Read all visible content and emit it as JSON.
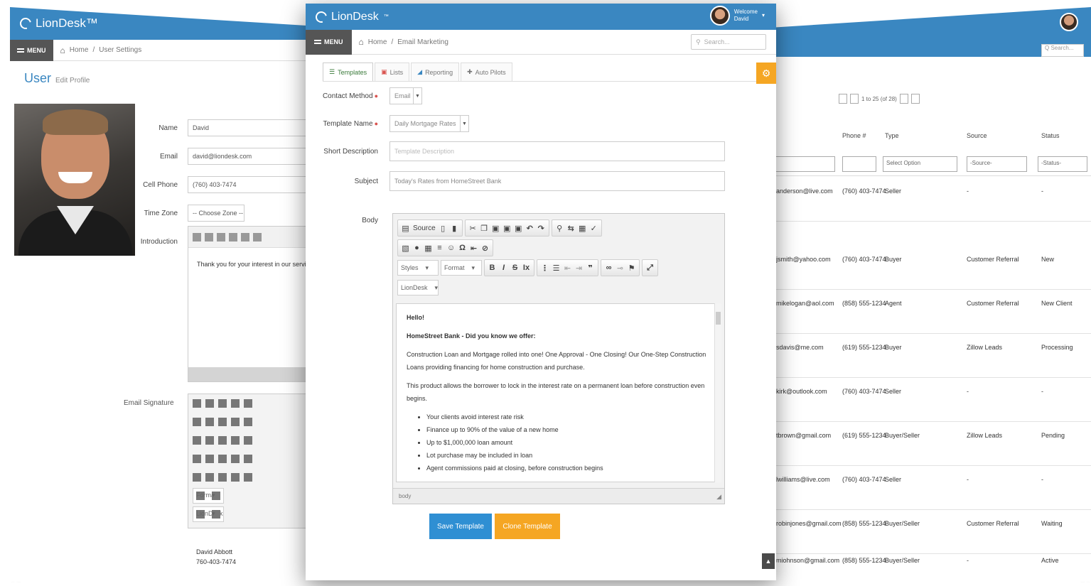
{
  "brand": {
    "name": "LionDesk",
    "mark": "™"
  },
  "colors": {
    "header": "#3a87c1",
    "save": "#2f8fd3",
    "clone": "#f5a623",
    "required": "#d9534f"
  },
  "left": {
    "logo": "LionDesk™",
    "menu": "MENU",
    "breadcrumb": [
      "Home",
      "User Settings"
    ],
    "title": "User",
    "title_small": "Edit Profile",
    "fields": [
      {
        "label": "Name",
        "value": "David"
      },
      {
        "label": "Email",
        "value": "david@liondesk.com"
      },
      {
        "label": "Cell Phone",
        "value": "(760) 403-7474"
      },
      {
        "label": "Time Zone",
        "value": "-- Choose Zone --"
      },
      {
        "label": "Introduction",
        "value": ""
      }
    ],
    "intro_text": "Thank you for your interest in our services",
    "signature_label": "Email Signature",
    "signature_lines": [
      "David Abbott",
      "760-403-7474"
    ],
    "format_combo": "Format",
    "liondesk_combo": "LionDesk"
  },
  "right": {
    "search_placeholder": "Q Search...",
    "pager": "1 to 25 (of 28)",
    "columns": [
      "Phone #",
      "Type",
      "Source",
      "Status"
    ],
    "filters": [
      "Select Option",
      "-Source-",
      "-Status-"
    ],
    "rows": [
      {
        "email": "anderson@live.com",
        "phone": "(760) 403-7474",
        "type": "Seller",
        "source": "-",
        "status": "-"
      },
      {
        "email": "jsmith@yahoo.com",
        "phone": "(760) 403-7474",
        "type": "Buyer",
        "source": "Customer Referral",
        "status": "New"
      },
      {
        "email": "mikelogan@aol.com",
        "phone": "(858) 555-1234",
        "type": "Agent",
        "source": "Customer Referral",
        "status": "New Client"
      },
      {
        "email": "sdavis@me.com",
        "phone": "(619) 555-1234",
        "type": "Buyer",
        "source": "Zillow Leads",
        "status": "Processing"
      },
      {
        "email": "kirk@outlook.com",
        "phone": "(760) 403-7474",
        "type": "Seller",
        "source": "-",
        "status": "-"
      },
      {
        "email": "tbrown@gmail.com",
        "phone": "(619) 555-1234",
        "type": "Buyer/Seller",
        "source": "Zillow Leads",
        "status": "Pending"
      },
      {
        "email": "lwilliams@live.com",
        "phone": "(760) 403-7474",
        "type": "Seller",
        "source": "-",
        "status": "-"
      },
      {
        "email": "robinjones@gmail.com",
        "phone": "(858) 555-1234",
        "type": "Buyer/Seller",
        "source": "Customer Referral",
        "status": "Waiting"
      },
      {
        "email": "mjohnson@gmail.com",
        "phone": "(858) 555-1234",
        "type": "Buyer/Seller",
        "source": "-",
        "status": "Active"
      }
    ]
  },
  "center": {
    "logo": "LionDesk",
    "logo_mark": "™",
    "user": {
      "welcome": "Welcome",
      "name": "David"
    },
    "menu": "MENU",
    "breadcrumb": {
      "home": "Home",
      "sep": "/",
      "current": "Email Marketing"
    },
    "search_placeholder": "Search...",
    "tabs": [
      {
        "label": "Templates",
        "icon": "☰"
      },
      {
        "label": "Lists",
        "icon": "▣"
      },
      {
        "label": "Reporting",
        "icon": "◢"
      },
      {
        "label": "Auto Pilots",
        "icon": "✚"
      }
    ],
    "form": {
      "contact_method": {
        "label": "Contact Method",
        "value": "Email"
      },
      "template_name": {
        "label": "Template Name",
        "value": "Daily Mortgage Rates"
      },
      "short_description": {
        "label": "Short Description",
        "placeholder": "Template Description"
      },
      "subject": {
        "label": "Subject",
        "value": "Today's Rates from HomeStreet Bank"
      },
      "body_label": "Body"
    },
    "editor": {
      "source": "Source",
      "styles": "Styles",
      "format": "Format",
      "liondesk": "LionDesk",
      "greeting": "Hello!",
      "headline": "HomeStreet Bank - Did you know we offer:",
      "para1": "Construction Loan and Mortgage rolled into one! One Approval - One Closing! Our One-Step Construction Loans providing financing for home construction and purchase.",
      "para2": "This product allows the borrower to lock in the interest rate on a permanent loan before construction even begins.",
      "bullets": [
        "Your clients avoid interest rate risk",
        "Finance up to 90% of the value of a new home",
        "Up to $1,000,000 loan amount",
        "Lot purchase may be included in loan",
        "Agent commissions paid at closing, before construction begins"
      ],
      "footer": "body"
    },
    "buttons": {
      "save": "Save Template",
      "clone": "Clone Template"
    },
    "scroll_top": "▲"
  }
}
